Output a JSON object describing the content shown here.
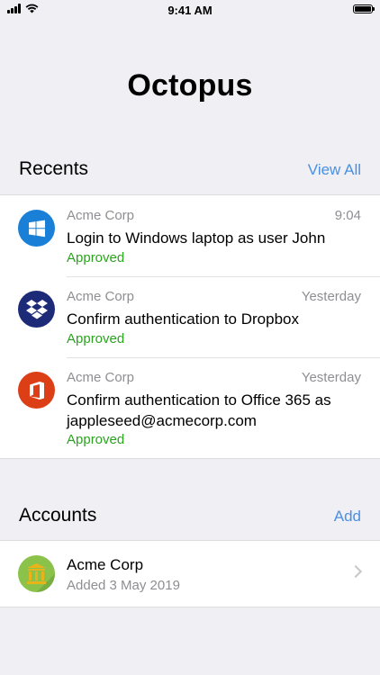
{
  "status_bar": {
    "time": "9:41 AM"
  },
  "app": {
    "title": "Octopus"
  },
  "recents": {
    "title": "Recents",
    "view_all_label": "View All",
    "items": [
      {
        "org": "Acme Corp",
        "time": "9:04",
        "text": "Login to Windows laptop as user John",
        "status": "Approved",
        "icon": "windows-logo-icon",
        "icon_color": "#1a7fd6"
      },
      {
        "org": "Acme Corp",
        "time": "Yesterday",
        "text": "Confirm authentication to Dropbox",
        "status": "Approved",
        "icon": "dropbox-logo-icon",
        "icon_color": "#1c2a78"
      },
      {
        "org": "Acme Corp",
        "time": "Yesterday",
        "text": "Confirm authentication to Office 365 as jappleseed@acmecorp.com",
        "status": "Approved",
        "icon": "office-logo-icon",
        "icon_color": "#dc3e15"
      }
    ]
  },
  "accounts": {
    "title": "Accounts",
    "add_label": "Add",
    "items": [
      {
        "name": "Acme Corp",
        "added": "Added 3 May 2019",
        "icon": "bank-building-icon",
        "icon_color": "#8bc34a"
      }
    ]
  },
  "colors": {
    "accent": "#4a90e2",
    "approved": "#2ba41e",
    "background": "#efeff4"
  }
}
